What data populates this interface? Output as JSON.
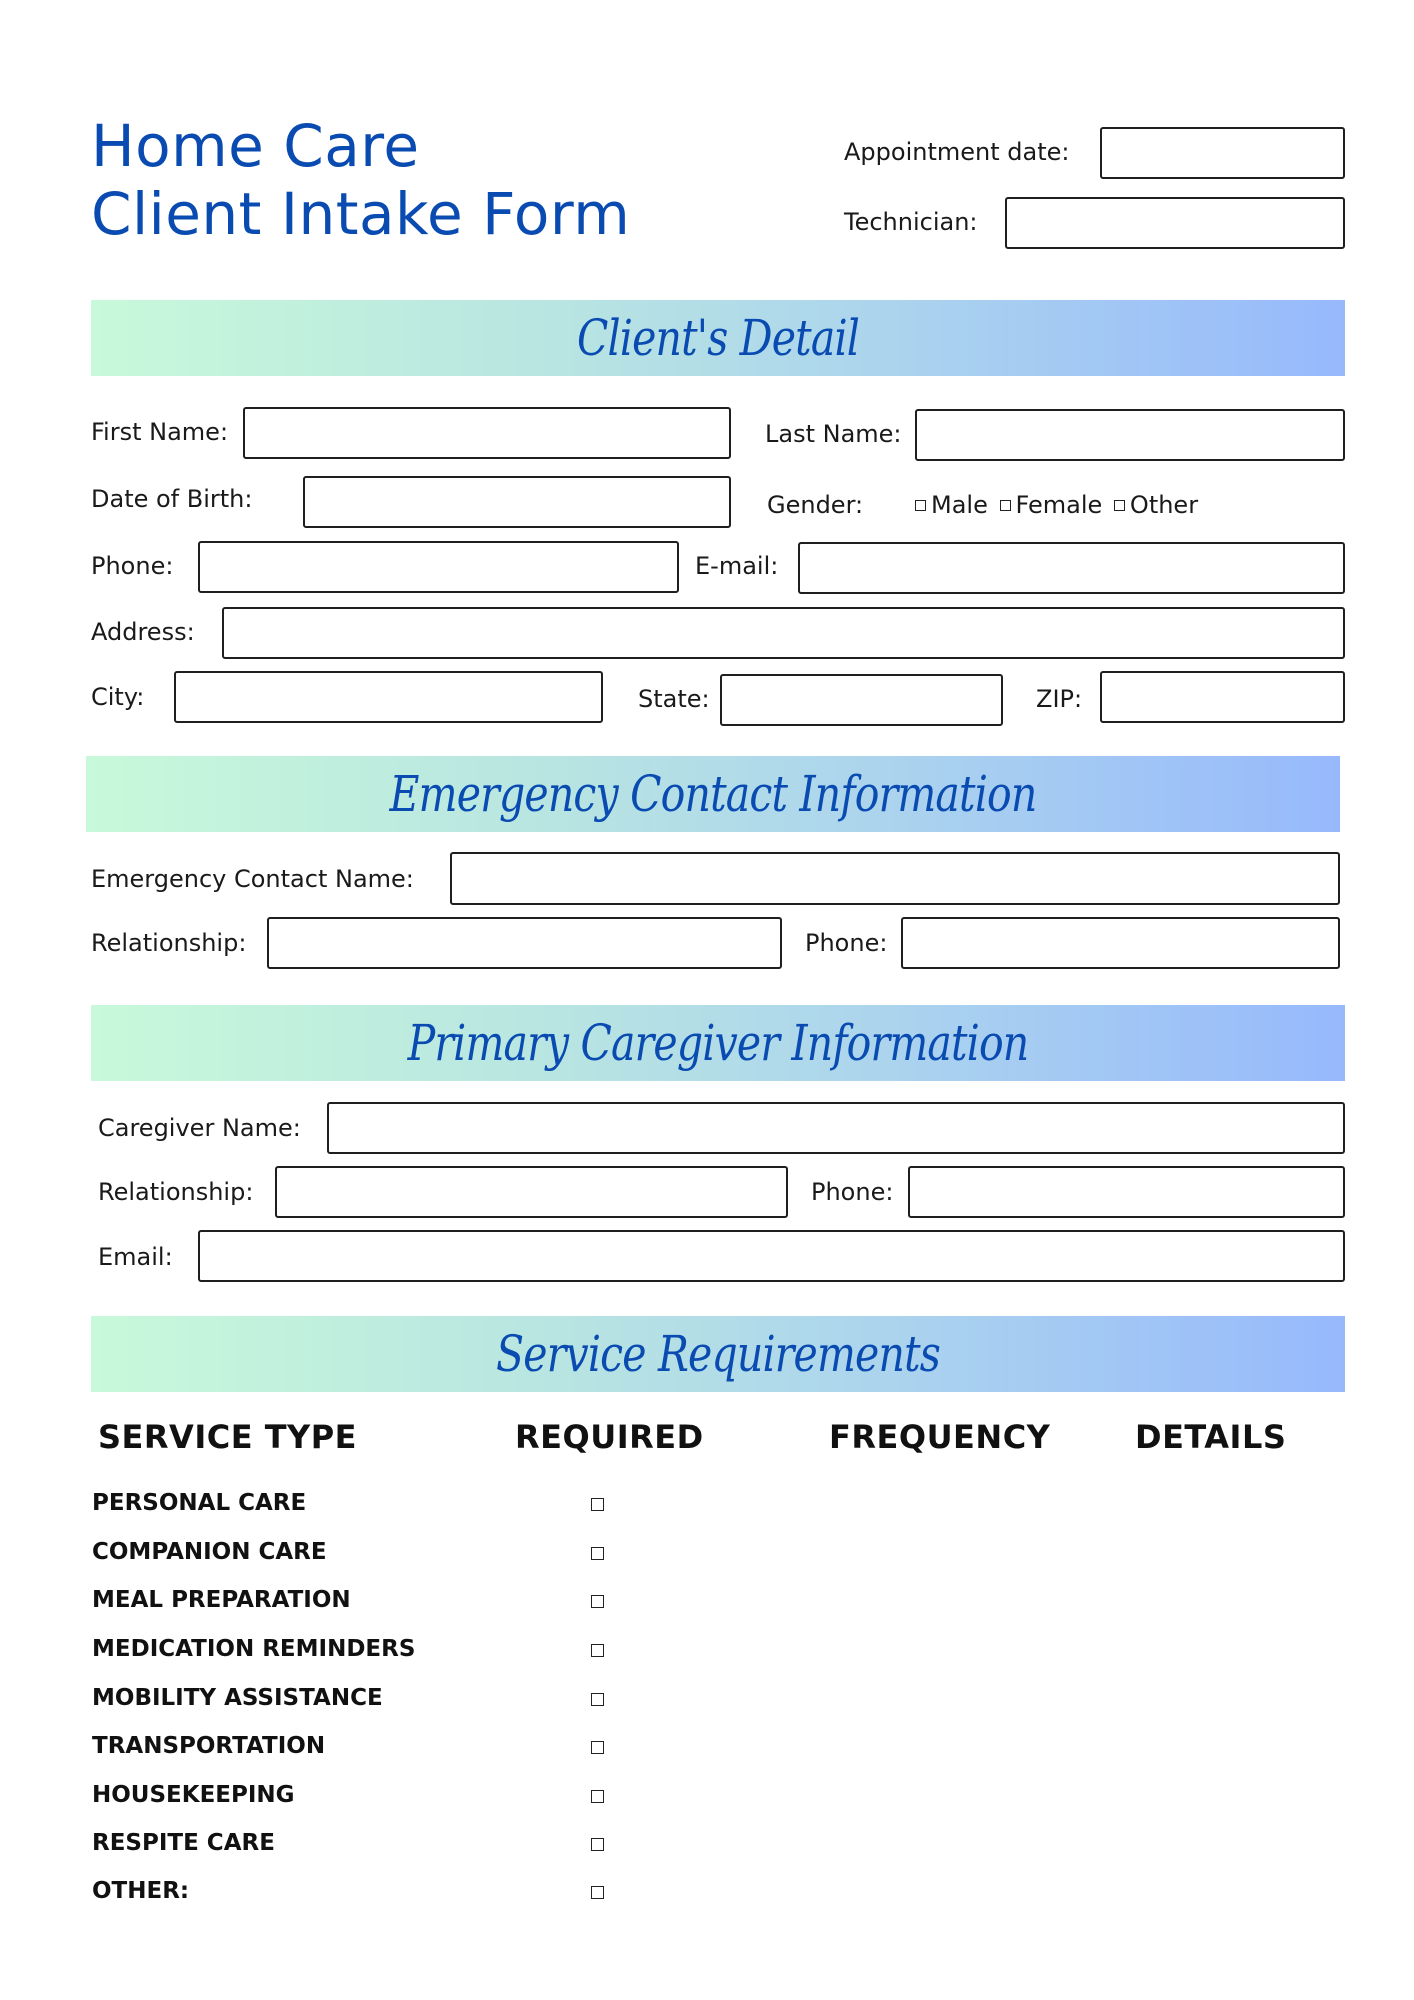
{
  "header": {
    "title_line1": "Home Care",
    "title_line2": "Client Intake Form",
    "appointment_label": "Appointment date:",
    "appointment_value": "",
    "technician_label": "Technician:",
    "technician_value": ""
  },
  "colors": {
    "title": "#0a4bb1",
    "banner_gradient_start": "#c8f9da",
    "banner_gradient_end": "#97b9fc",
    "text": "#111111",
    "box_border": "#1f1f1f"
  },
  "client_details": {
    "heading": "Client's Detail",
    "first_name_label": "First Name:",
    "last_name_label": "Last Name:",
    "dob_label": "Date of Birth:",
    "gender_label": "Gender:",
    "gender_options": [
      "Male",
      "Female",
      "Other"
    ],
    "phone_label": "Phone:",
    "email_label": "E-mail:",
    "address_label": "Address:",
    "city_label": "City:",
    "state_label": "State:",
    "zip_label": "ZIP:",
    "values": {
      "first_name": "",
      "last_name": "",
      "dob": "",
      "phone": "",
      "email": "",
      "address": "",
      "city": "",
      "state": "",
      "zip": ""
    }
  },
  "emergency_contact": {
    "heading": "Emergency Contact Information",
    "name_label": "Emergency Contact Name:",
    "relationship_label": "Relationship:",
    "phone_label": "Phone:",
    "values": {
      "name": "",
      "relationship": "",
      "phone": ""
    }
  },
  "primary_caregiver": {
    "heading": "Primary Caregiver Information",
    "name_label": "Caregiver Name:",
    "relationship_label": "Relationship:",
    "phone_label": "Phone:",
    "email_label": "Email:",
    "values": {
      "name": "",
      "relationship": "",
      "phone": "",
      "email": ""
    }
  },
  "service_requirements": {
    "heading": "Service Requirements",
    "columns": [
      "SERVICE TYPE",
      "REQUIRED",
      "FREQUENCY",
      "DETAILS"
    ],
    "services": [
      {
        "name": "PERSONAL CARE",
        "required": false
      },
      {
        "name": "COMPANION CARE",
        "required": false
      },
      {
        "name": "MEAL PREPARATION",
        "required": false
      },
      {
        "name": "MEDICATION REMINDERS",
        "required": false
      },
      {
        "name": "MOBILITY ASSISTANCE",
        "required": false
      },
      {
        "name": "TRANSPORTATION",
        "required": false
      },
      {
        "name": "HOUSEKEEPING",
        "required": false
      },
      {
        "name": "RESPITE CARE",
        "required": false
      },
      {
        "name": "OTHER:",
        "required": false
      }
    ]
  }
}
